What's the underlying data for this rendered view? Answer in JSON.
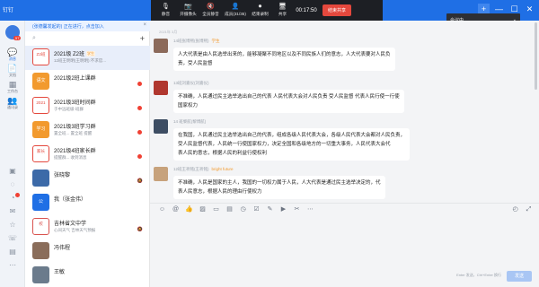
{
  "app": {
    "title": "钉钉"
  },
  "window": {
    "add_label": "+",
    "minimize_label": "—",
    "maximize_label": "☐",
    "close_label": "✕"
  },
  "meeting_bar": {
    "items": [
      {
        "label": "静音",
        "icon": "🎙"
      },
      {
        "label": "开摄像头",
        "icon": "📷"
      },
      {
        "label": "全员静音",
        "icon": "🔇"
      },
      {
        "label": "成员(31/35)",
        "icon": "👤"
      },
      {
        "label": "结束录制",
        "icon": "⏺"
      },
      {
        "label": "共享",
        "icon": "🖥"
      }
    ],
    "timer": "00:17:50",
    "end_button": "结束共享"
  },
  "speaker_popup": {
    "label": "会议中"
  },
  "sidebar": {
    "badge": "57",
    "items": [
      {
        "label": "消息",
        "icon": "💬"
      },
      {
        "label": "文档",
        "icon": "📄"
      },
      {
        "label": "工作台",
        "icon": "▦"
      },
      {
        "label": "通讯录",
        "icon": "👥"
      }
    ]
  },
  "conv_list": {
    "notice": "(张德馨发起的) 正在进行，点击加入",
    "items": [
      {
        "name": "2021级 Z2班",
        "tag": "学生",
        "sub": "12班王明明(王明明):不求官...",
        "time": "",
        "avatar_text": "Z2班",
        "avatar_color": "#e4483d",
        "outline": true
      },
      {
        "name": "2021级2班上课群",
        "tag": "",
        "sub": "",
        "time": "",
        "avatar_text": "语文",
        "avatar_color": "#f29a2e",
        "outline": false
      },
      {
        "name": "2021级3班时间群",
        "tag": "",
        "sub": "于中远班级-班群",
        "time": "",
        "avatar_text": "2021",
        "avatar_color": "#e4483d",
        "outline": true
      },
      {
        "name": "2021级3班学习群",
        "tag": "",
        "sub": "置全班... 置全班 提醒",
        "time": "",
        "avatar_text": "学习",
        "avatar_color": "#f29a2e",
        "outline": false
      },
      {
        "name": "2021级4班家长群",
        "tag": "",
        "sub": "提醒群... 收到消息",
        "time": "",
        "avatar_text": "家长",
        "avatar_color": "#e4483d",
        "outline": true
      },
      {
        "name": "张晓黎",
        "tag": "",
        "sub": "",
        "time": "",
        "avatar_text": "",
        "avatar_color": "#3c6aa8",
        "outline": false
      },
      {
        "name": "我（张金伟）",
        "tag": "",
        "sub": "",
        "time": "",
        "avatar_text": "公",
        "avatar_color": "#1f6fe5",
        "outline": false
      },
      {
        "name": "吉林省文中学",
        "tag": "",
        "sub": "心间天气 吉林天气预报",
        "time": "",
        "avatar_text": "校",
        "avatar_color": "#d9534f",
        "outline": true
      },
      {
        "name": "冯伟程",
        "tag": "",
        "sub": "",
        "time": "",
        "avatar_text": "",
        "avatar_color": "#8a6d5a",
        "outline": false
      },
      {
        "name": "王敏",
        "tag": "",
        "sub": "",
        "time": "",
        "avatar_text": "",
        "avatar_color": "#6b7b8c",
        "outline": false
      }
    ]
  },
  "messages": {
    "date": "2021年 3月",
    "items": [
      {
        "meta": "14班张博熙(张博熙)",
        "tag": "学生",
        "text1": "人大代表是由人民选举出来的，能够凝聚不同地区以及不同民族人们的意志，人大代表要对人民负",
        "text2": "责，受人民监督",
        "avatar_color": "#8c6a5a"
      },
      {
        "meta": "13班刘嘉仪(刘嘉仪)",
        "tag": "",
        "text1": "不准确，人民通过民主选举选出自己的代表 人民代表大会对人民负责 受人民监督 代表人民行使一行使",
        "text2": "国家权力",
        "avatar_color": "#b0372f"
      },
      {
        "meta": "14 班黎航(黎博航)",
        "tag": "",
        "text1": "在我国，人民通过民主选举选出自己的代表，组成各级人民代表大会，各级人民代表大会都对人民负责，",
        "text2": "受人民监督代表，人民统一行使国家权力，决定全国和各级地方的一切重大事务，人民代表大会代",
        "text3": "表人民的意志，根据人民的利益行使权利",
        "avatar_color": "#3d4d63"
      },
      {
        "meta": "12班王祈铭(王祈铭)",
        "tag": "bright future",
        "text1": "不准确，人民是国家的主人，我国的一切权力属于人民，人大代表是通过民主选举决定的，代",
        "text2": "表人民意志，根据人民的理由行使权力",
        "avatar_color": "#c7a27c"
      }
    ]
  },
  "toolbar": {
    "icons": [
      "emoji-icon",
      "at-icon",
      "like-icon",
      "image-icon",
      "file-icon",
      "folder-icon",
      "clock-icon",
      "check-icon",
      "edit-icon",
      "video-icon",
      "screenshot-icon",
      "more-icon"
    ],
    "right_icons": [
      "history-icon",
      "expand-icon"
    ]
  },
  "input": {
    "hint": "Enter 发送，Ctrl+Enter 换行",
    "send_label": "发送"
  }
}
